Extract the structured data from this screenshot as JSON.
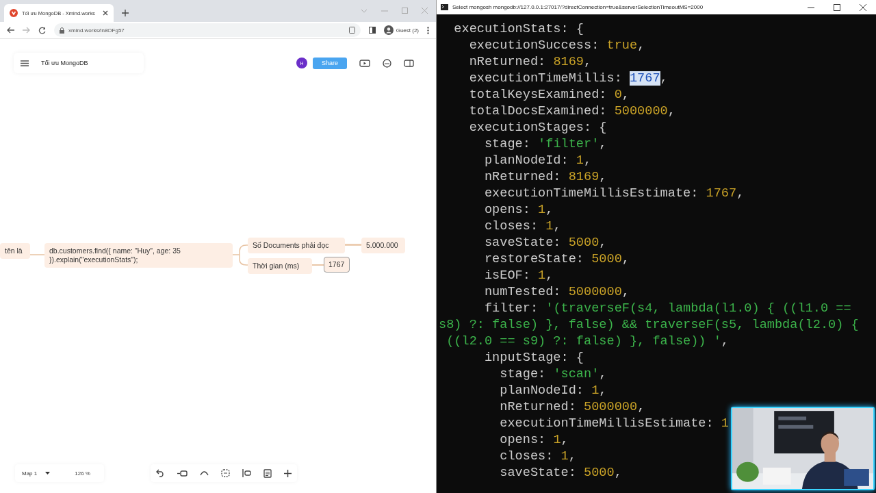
{
  "browser": {
    "tab": {
      "title": "Tối ưu MongoDB - Xmind.works"
    },
    "address": "xmind.works/ln8OFg57",
    "profile": "Guest (2)",
    "app": {
      "doc_title": "Tối ưu MongoDB",
      "avatar": "H",
      "share": "Share"
    },
    "mindmap": {
      "nodes": [
        {
          "text": "tên là",
          "kind": "topic"
        },
        {
          "text": "db.customers.find({ name: \"Huy\", age: 35\n}).explain(\"executionStats\");",
          "kind": "topic"
        },
        {
          "text": "Số Documents phải đọc",
          "kind": "topic"
        },
        {
          "text": "5.000.000",
          "kind": "topic"
        },
        {
          "text": "Thời gian (ms)",
          "kind": "topic"
        },
        {
          "text": "1767",
          "kind": "selected"
        }
      ]
    },
    "footer": {
      "sheet": "Map 1",
      "zoom": "126 %"
    }
  },
  "terminal": {
    "title": "Select mongosh mongodb://127.0.0.1:27017/?directConnection=true&serverSelectionTimeoutMS=2000",
    "lines": [
      [
        {
          "text": "  executionStats: {",
          "kind": "key"
        }
      ],
      [
        {
          "text": "    executionSuccess: ",
          "kind": "key"
        },
        {
          "text": "true",
          "kind": "boolean"
        },
        {
          "text": ",",
          "kind": "key"
        }
      ],
      [
        {
          "text": "    nReturned: ",
          "kind": "key"
        },
        {
          "text": "8169",
          "kind": "number"
        },
        {
          "text": ",",
          "kind": "key"
        }
      ],
      [
        {
          "text": "    executionTimeMillis: ",
          "kind": "key"
        },
        {
          "text": "1767",
          "kind": "highlight"
        },
        {
          "text": ",",
          "kind": "key"
        }
      ],
      [
        {
          "text": "    totalKeysExamined: ",
          "kind": "key"
        },
        {
          "text": "0",
          "kind": "number"
        },
        {
          "text": ",",
          "kind": "key"
        }
      ],
      [
        {
          "text": "    totalDocsExamined: ",
          "kind": "key"
        },
        {
          "text": "5000000",
          "kind": "number"
        },
        {
          "text": ",",
          "kind": "key"
        }
      ],
      [
        {
          "text": "    executionStages: {",
          "kind": "key"
        }
      ],
      [
        {
          "text": "      stage: ",
          "kind": "key"
        },
        {
          "text": "'filter'",
          "kind": "string"
        },
        {
          "text": ",",
          "kind": "key"
        }
      ],
      [
        {
          "text": "      planNodeId: ",
          "kind": "key"
        },
        {
          "text": "1",
          "kind": "number"
        },
        {
          "text": ",",
          "kind": "key"
        }
      ],
      [
        {
          "text": "      nReturned: ",
          "kind": "key"
        },
        {
          "text": "8169",
          "kind": "number"
        },
        {
          "text": ",",
          "kind": "key"
        }
      ],
      [
        {
          "text": "      executionTimeMillisEstimate: ",
          "kind": "key"
        },
        {
          "text": "1767",
          "kind": "number"
        },
        {
          "text": ",",
          "kind": "key"
        }
      ],
      [
        {
          "text": "      opens: ",
          "kind": "key"
        },
        {
          "text": "1",
          "kind": "number"
        },
        {
          "text": ",",
          "kind": "key"
        }
      ],
      [
        {
          "text": "      closes: ",
          "kind": "key"
        },
        {
          "text": "1",
          "kind": "number"
        },
        {
          "text": ",",
          "kind": "key"
        }
      ],
      [
        {
          "text": "      saveState: ",
          "kind": "key"
        },
        {
          "text": "5000",
          "kind": "number"
        },
        {
          "text": ",",
          "kind": "key"
        }
      ],
      [
        {
          "text": "      restoreState: ",
          "kind": "key"
        },
        {
          "text": "5000",
          "kind": "number"
        },
        {
          "text": ",",
          "kind": "key"
        }
      ],
      [
        {
          "text": "      isEOF: ",
          "kind": "key"
        },
        {
          "text": "1",
          "kind": "number"
        },
        {
          "text": ",",
          "kind": "key"
        }
      ],
      [
        {
          "text": "      numTested: ",
          "kind": "key"
        },
        {
          "text": "5000000",
          "kind": "number"
        },
        {
          "text": ",",
          "kind": "key"
        }
      ],
      [
        {
          "text": "      filter: ",
          "kind": "key"
        },
        {
          "text": "'(traverseF(s4, lambda(l1.0) { ((l1.0 ==",
          "kind": "string"
        }
      ],
      [
        {
          "text": "s8) ?: false) }, false) && traverseF(s5, lambda(l2.0) {",
          "kind": "string"
        }
      ],
      [
        {
          "text": " ((l2.0 == s9) ?: false) }, false)) '",
          "kind": "string"
        },
        {
          "text": ",",
          "kind": "key"
        }
      ],
      [
        {
          "text": "      inputStage: {",
          "kind": "key"
        }
      ],
      [
        {
          "text": "        stage: ",
          "kind": "key"
        },
        {
          "text": "'scan'",
          "kind": "string"
        },
        {
          "text": ",",
          "kind": "key"
        }
      ],
      [
        {
          "text": "        planNodeId: ",
          "kind": "key"
        },
        {
          "text": "1",
          "kind": "number"
        },
        {
          "text": ",",
          "kind": "key"
        }
      ],
      [
        {
          "text": "        nReturned: ",
          "kind": "key"
        },
        {
          "text": "5000000",
          "kind": "number"
        },
        {
          "text": ",",
          "kind": "key"
        }
      ],
      [
        {
          "text": "        executionTimeMillisEstimate: ",
          "kind": "key"
        },
        {
          "text": "1",
          "kind": "number"
        }
      ],
      [
        {
          "text": "        opens: ",
          "kind": "key"
        },
        {
          "text": "1",
          "kind": "number"
        },
        {
          "text": ",",
          "kind": "key"
        }
      ],
      [
        {
          "text": "        closes: ",
          "kind": "key"
        },
        {
          "text": "1",
          "kind": "number"
        },
        {
          "text": ",",
          "kind": "key"
        }
      ],
      [
        {
          "text": "        saveState: ",
          "kind": "key"
        },
        {
          "text": "5000",
          "kind": "number"
        },
        {
          "text": ",",
          "kind": "key"
        }
      ]
    ]
  }
}
